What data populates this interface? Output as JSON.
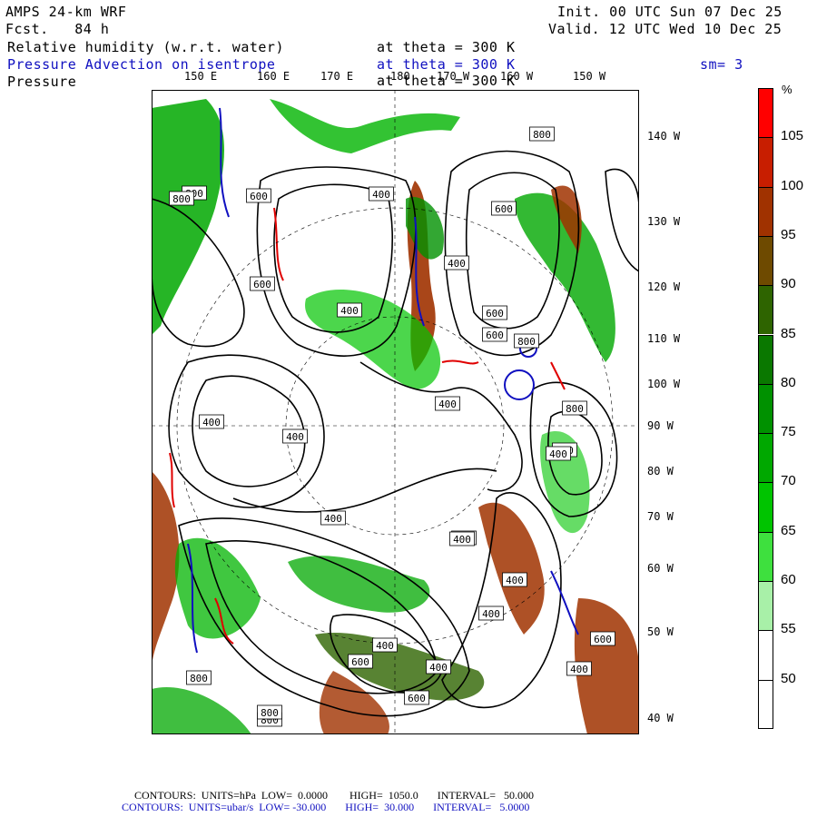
{
  "header": {
    "model": "AMPS 24-km WRF",
    "fcst_label": "Fcst.",
    "fcst_value": "84 h",
    "init": "Init. 00 UTC Sun 07 Dec 25",
    "valid": "Valid. 12 UTC Wed 10 Dec 25",
    "field1_name": "Relative humidity (w.r.t. water)",
    "field1_level": "at theta = 300 K",
    "field2_name": "Pressure Advection on isentrope",
    "field2_level": "at theta = 300 K",
    "field2_smooth": "sm= 3",
    "field3_name": "Pressure",
    "field3_level": "at theta = 300 K"
  },
  "lon_labels": [
    "150 E",
    "160 E",
    "170 E",
    "180",
    "170 W",
    "160 W",
    "150 W"
  ],
  "lat_labels": [
    "140 W",
    "130 W",
    "120 W",
    "110 W",
    "100 W",
    "90 W",
    "80 W",
    "70 W",
    "60 W",
    "50 W",
    "40 W"
  ],
  "contour_labels": [
    "800",
    "600",
    "400",
    "800",
    "600",
    "800",
    "400",
    "400",
    "600",
    "400",
    "400",
    "400",
    "800",
    "800",
    "600",
    "800",
    "600",
    "400",
    "400",
    "800",
    "400",
    "400",
    "400",
    "400",
    "600",
    "800",
    "800",
    "600",
    "600",
    "400",
    "400",
    "400"
  ],
  "colorbar": {
    "unit": "%",
    "levels": [
      "105",
      "100",
      "95",
      "90",
      "85",
      "80",
      "75",
      "70",
      "65",
      "60",
      "55",
      "50"
    ],
    "colors": [
      "#ff0000",
      "#c81e00",
      "#a03200",
      "#6e4a00",
      "#2e6400",
      "#0a7800",
      "#009100",
      "#00a800",
      "#00c400",
      "#3ee03e",
      "#a8f0a8",
      "#ffffff",
      "#ffffff"
    ]
  },
  "footer": {
    "line1": "CONTOURS:  UNITS=hPa  LOW=  0.0000        HIGH=  1050.0       INTERVAL=   50.000",
    "line2": "CONTOURS:  UNITS=ubar/s  LOW= -30.000       HIGH=  30.000       INTERVAL=   5.0000"
  }
}
